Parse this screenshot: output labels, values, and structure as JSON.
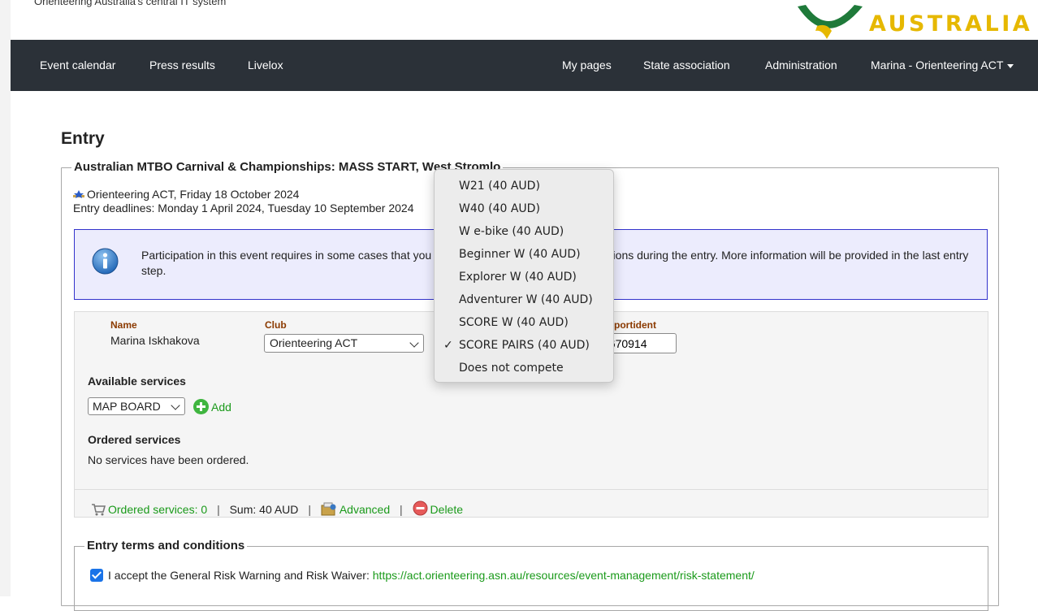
{
  "header": {
    "tagline": "Orienteering Australia's central IT system",
    "logo_text": "AUSTRALIA",
    "logo_color": "#e6b800"
  },
  "nav": {
    "left": [
      "Event calendar",
      "Press results",
      "Livelox"
    ],
    "right": [
      "My pages",
      "State association",
      "Administration",
      "Marina - Orienteering ACT"
    ],
    "background": "#2b3138"
  },
  "page": {
    "title": "Entry"
  },
  "event": {
    "title": "Australian MTBO Carnival & Championships: MASS START, West Stromlo",
    "organiser_date": "Orienteering ACT, Friday 18 October 2024",
    "deadlines": "Entry deadlines: Monday 1 April 2024, Tuesday 10 September 2024"
  },
  "info": {
    "text": "Participation in this event requires in some cases that you approve the event terms and conditions during the entry. More information will be provided in the last entry step."
  },
  "participant": {
    "name_label": "Name",
    "name": "Marina Iskhakova",
    "club_label": "Club",
    "club_value": "Orienteering ACT",
    "sportident_label": "Sportident",
    "sportident_value": "8670914"
  },
  "services": {
    "available_label": "Available services",
    "selected": "MAP BOARD",
    "add_label": "Add",
    "ordered_label": "Ordered services",
    "none_text": "No services have been ordered."
  },
  "footer": {
    "ordered_count": "Ordered services: 0",
    "sum": "Sum: 40 AUD",
    "advanced": "Advanced",
    "delete": "Delete",
    "separator": "|"
  },
  "terms": {
    "legend": "Entry terms and conditions",
    "accept_text": "I accept the General Risk Warning and Risk Waiver:",
    "accept_link": "https://act.orienteering.asn.au/resources/event-management/risk-statement/",
    "checked": true
  },
  "class_dropdown": {
    "options": [
      "W21 (40 AUD)",
      "W40 (40 AUD)",
      "W e-bike (40 AUD)",
      "Beginner W (40 AUD)",
      "Explorer W (40 AUD)",
      "Adventurer W (40 AUD)",
      "SCORE W (40 AUD)",
      "SCORE PAIRS (40 AUD)",
      "Does not compete"
    ],
    "selected_index": 7,
    "check_mark": "✓"
  }
}
